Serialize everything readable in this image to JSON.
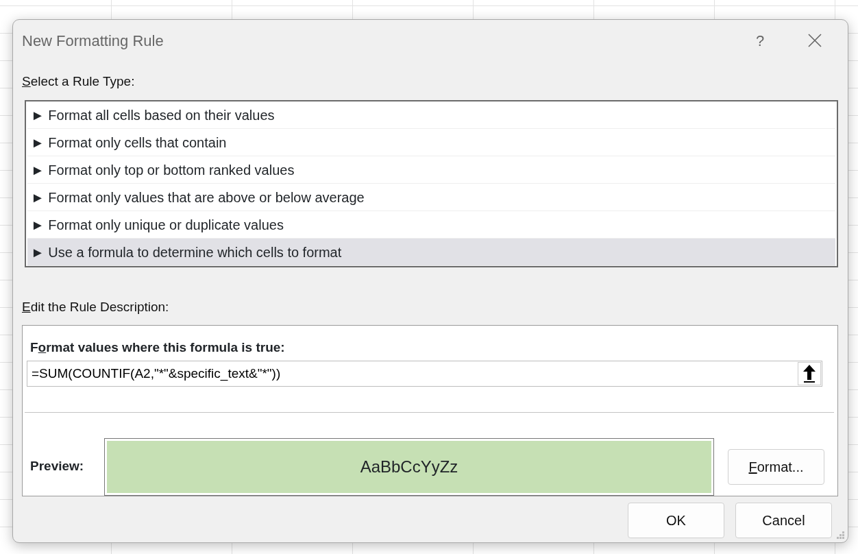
{
  "window": {
    "title": "New Formatting Rule",
    "help": "?"
  },
  "rule_type_label": {
    "key": "S",
    "after": "elect a Rule Type:"
  },
  "rule_types": [
    {
      "label": "► Format all cells based on their values",
      "selected": false
    },
    {
      "label": "► Format only cells that contain",
      "selected": false
    },
    {
      "label": "► Format only top or bottom ranked values",
      "selected": false
    },
    {
      "label": "► Format only values that are above or below average",
      "selected": false
    },
    {
      "label": "► Format only unique or duplicate values",
      "selected": false
    },
    {
      "label": "► Use a formula to determine which cells to format",
      "selected": true
    }
  ],
  "description_label": {
    "key": "E",
    "after": "dit the Rule Description:"
  },
  "formula_label": {
    "before": "F",
    "key": "o",
    "after": "rmat values where this formula is true:"
  },
  "formula": {
    "value": "=SUM(COUNTIF(A2,\"*\"&specific_text&\"*\"))"
  },
  "preview": {
    "label": "Preview:",
    "sample": "AaBbCcYyZz",
    "color": "#c6e0b4"
  },
  "format_button": {
    "key": "F",
    "after": "ormat..."
  },
  "buttons": [
    "OK",
    "Cancel"
  ]
}
